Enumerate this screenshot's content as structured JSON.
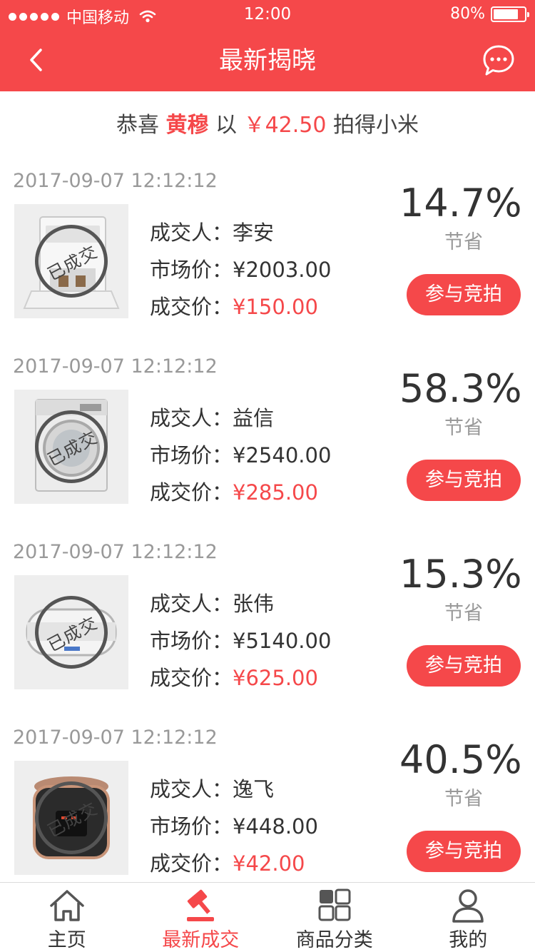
{
  "status_bar": {
    "carrier": "中国移动",
    "time": "12:00",
    "battery": "80%",
    "battery_level": 0.8
  },
  "header": {
    "title": "最新揭晓",
    "back_icon": "chevron-left-icon",
    "message_icon": "chat-bubble-icon"
  },
  "winner": {
    "prefix": "恭喜",
    "name": "黄穆",
    "mid": "以",
    "price": "￥42.50",
    "suffix": "拍得小米"
  },
  "labels": {
    "buyer": "成交人：",
    "market": "市场价：",
    "deal": "成交价：",
    "save": "节省",
    "join": "参与竞拍",
    "stamp": "已成交"
  },
  "colors": {
    "accent": "#f5484a",
    "text": "#333333",
    "muted": "#999999"
  },
  "items": [
    {
      "date": "2017-09-07 12:12:12",
      "buyer": "李安",
      "market_price": "¥2003.00",
      "deal_price": "¥150.00",
      "saving": "14.7%",
      "product_icon": "coffee-machine-icon"
    },
    {
      "date": "2017-09-07 12:12:12",
      "buyer": "益信",
      "market_price": "¥2540.00",
      "deal_price": "¥285.00",
      "saving": "58.3%",
      "product_icon": "washing-machine-icon"
    },
    {
      "date": "2017-09-07 12:12:12",
      "buyer": "张伟",
      "market_price": "¥5140.00",
      "deal_price": "¥625.00",
      "saving": "15.3%",
      "product_icon": "water-heater-icon"
    },
    {
      "date": "2017-09-07 12:12:12",
      "buyer": "逸飞",
      "market_price": "¥448.00",
      "deal_price": "¥42.00",
      "saving": "40.5%",
      "product_icon": "rice-cooker-icon"
    }
  ],
  "tabs": [
    {
      "label": "主页",
      "icon": "home-icon",
      "active": false
    },
    {
      "label": "最新成交",
      "icon": "gavel-icon",
      "active": true
    },
    {
      "label": "商品分类",
      "icon": "grid-icon",
      "active": false
    },
    {
      "label": "我的",
      "icon": "user-icon",
      "active": false
    }
  ]
}
